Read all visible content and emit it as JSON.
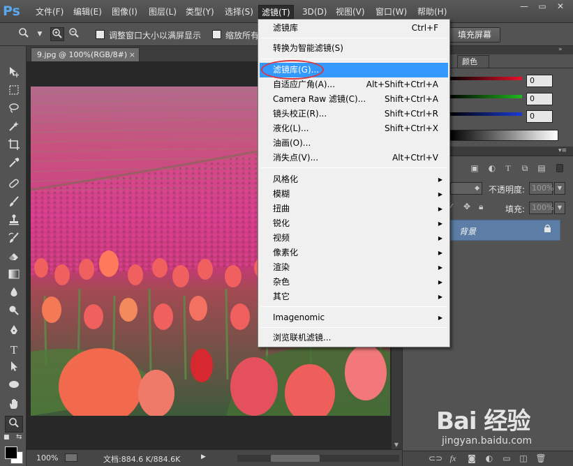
{
  "app": {
    "logo": "Ps"
  },
  "menubar": {
    "items": [
      "文件(F)",
      "编辑(E)",
      "图像(I)",
      "图层(L)",
      "类型(Y)",
      "选择(S)",
      "滤镜(T)",
      "3D(D)",
      "视图(V)",
      "窗口(W)",
      "帮助(H)"
    ],
    "active": "滤镜(T)"
  },
  "window_controls": {
    "minimize": "—",
    "restore": "▭",
    "close": "✕"
  },
  "options": {
    "fit_window_label": "调整窗口大小以满屏显示",
    "zoom_all_label": "缩放所有",
    "fill_screen_button": "填充屏幕"
  },
  "document": {
    "tab_title": "9.jpg @ 100%(RGB/8#)",
    "tab_close": "×",
    "zoom": "100%",
    "doc_size": "文档:884.6 K/884.6K"
  },
  "color_panel": {
    "tab": "颜色",
    "values": [
      "0",
      "0",
      "0"
    ],
    "colors": {
      "r": "#e8102a",
      "g": "#1fb81f",
      "b": "#1a3bd6"
    }
  },
  "layers_panel": {
    "opacity_label": "不透明度:",
    "opacity_value": "100%",
    "fill_label": "填充:",
    "fill_value": "100%",
    "layer_name": "背景"
  },
  "filter_menu": {
    "items": [
      {
        "label": "滤镜库",
        "shortcut": "Ctrl+F"
      },
      {
        "label": "转换为智能滤镜(S)"
      },
      {
        "label": "滤镜库(G)...",
        "highlighted": true
      },
      {
        "label": "自适应广角(A)...",
        "shortcut": "Alt+Shift+Ctrl+A"
      },
      {
        "label": "Camera Raw 滤镜(C)...",
        "shortcut": "Shift+Ctrl+A"
      },
      {
        "label": "镜头校正(R)...",
        "shortcut": "Shift+Ctrl+R"
      },
      {
        "label": "液化(L)...",
        "shortcut": "Shift+Ctrl+X"
      },
      {
        "label": "油画(O)..."
      },
      {
        "label": "消失点(V)...",
        "shortcut": "Alt+Ctrl+V"
      },
      {
        "label": "风格化",
        "submenu": true
      },
      {
        "label": "模糊",
        "submenu": true
      },
      {
        "label": "扭曲",
        "submenu": true
      },
      {
        "label": "锐化",
        "submenu": true
      },
      {
        "label": "视频",
        "submenu": true
      },
      {
        "label": "像素化",
        "submenu": true
      },
      {
        "label": "渲染",
        "submenu": true
      },
      {
        "label": "杂色",
        "submenu": true
      },
      {
        "label": "其它",
        "submenu": true
      },
      {
        "label": "Imagenomic",
        "submenu": true
      },
      {
        "label": "浏览联机滤镜..."
      }
    ]
  },
  "watermark": {
    "logo": "Bai 经验",
    "url": "jingyan.baidu.com"
  }
}
